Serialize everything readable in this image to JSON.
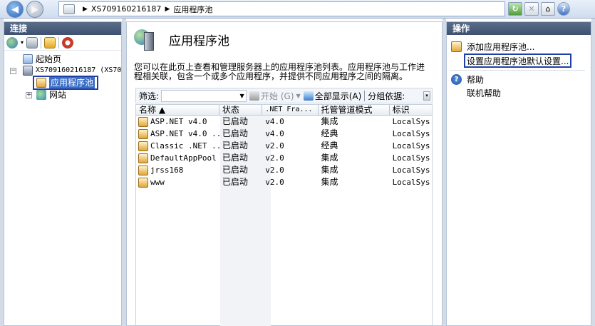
{
  "address_bar": {
    "path": [
      "XS709160216187",
      "应用程序池"
    ]
  },
  "toolbar_icons": [
    "refresh-icon",
    "stop-icon",
    "home-icon",
    "help-icon"
  ],
  "connections": {
    "title": "连接",
    "tree": [
      {
        "label": "起始页",
        "level": 1
      },
      {
        "label": "XS709160216187 (XS70",
        "level": 1
      },
      {
        "label": "应用程序池",
        "level": 2,
        "selected": true
      },
      {
        "label": "网站",
        "level": 2
      }
    ]
  },
  "main": {
    "title": "应用程序池",
    "description_line1": "您可以在此页上查看和管理服务器上的应用程序池列表。应用程序池与工作进",
    "description_line2": "程相关联，包含一个或多个应用程序，并提供不同应用程序之间的隔离。",
    "filter": {
      "label": "筛选:",
      "start_label": "开始 (G)",
      "show_all_label": "全部显示(A)",
      "group_label": "分组依据:"
    },
    "columns": [
      "名称 ▲",
      "状态",
      ".NET Fra...",
      "托管管道模式",
      "标识"
    ],
    "rows": [
      {
        "name": "ASP.NET v4.0",
        "status": "已启动",
        "net": "v4.0",
        "pipeline": "集成",
        "identity": "LocalSys"
      },
      {
        "name": "ASP.NET v4.0 ...",
        "status": "已启动",
        "net": "v4.0",
        "pipeline": "经典",
        "identity": "LocalSys"
      },
      {
        "name": "Classic .NET ...",
        "status": "已启动",
        "net": "v2.0",
        "pipeline": "经典",
        "identity": "LocalSys"
      },
      {
        "name": "DefaultAppPool",
        "status": "已启动",
        "net": "v2.0",
        "pipeline": "集成",
        "identity": "LocalSys"
      },
      {
        "name": "jrss168",
        "status": "已启动",
        "net": "v2.0",
        "pipeline": "集成",
        "identity": "LocalSys"
      },
      {
        "name": "www",
        "status": "已启动",
        "net": "v2.0",
        "pipeline": "集成",
        "identity": "LocalSys"
      }
    ]
  },
  "actions": {
    "title": "操作",
    "add_pool": "添加应用程序池...",
    "set_defaults": "设置应用程序池默认设置...",
    "help": "帮助",
    "online_help": "联机帮助"
  },
  "colors": {
    "panel_header": "#4a5d7c",
    "highlight_border": "#1f3fa8",
    "selection": "#3a6ec6"
  }
}
